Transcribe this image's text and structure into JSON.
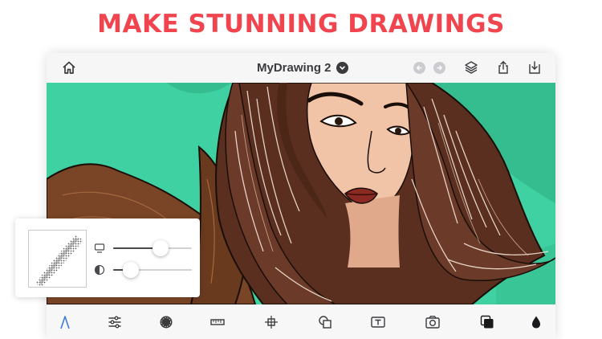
{
  "headline": "MAKE STUNNING DRAWINGS",
  "document": {
    "title": "MyDrawing 2"
  },
  "top_bar": {
    "icons": [
      "home-icon",
      "chevron-down-icon",
      "undo-icon",
      "redo-icon",
      "layers-icon",
      "share-icon",
      "download-icon"
    ]
  },
  "brush_panel": {
    "size_value": 0.6,
    "opacity_value": 0.22,
    "icons": [
      "size-icon",
      "opacity-icon"
    ]
  },
  "toolbar": {
    "tools": [
      "brush-icon",
      "adjustments-icon",
      "color-wheel-icon",
      "ruler-icon",
      "transform-icon",
      "shapes-icon",
      "text-icon",
      "camera-icon",
      "layers-stack-icon",
      "fill-drop-icon"
    ]
  },
  "colors": {
    "headline": "#f0454f",
    "canvas_background": "#3fd1a1",
    "hair": "#6b3a28",
    "jacket": "#7a4526",
    "accent_tool": "#3d7dd8"
  }
}
